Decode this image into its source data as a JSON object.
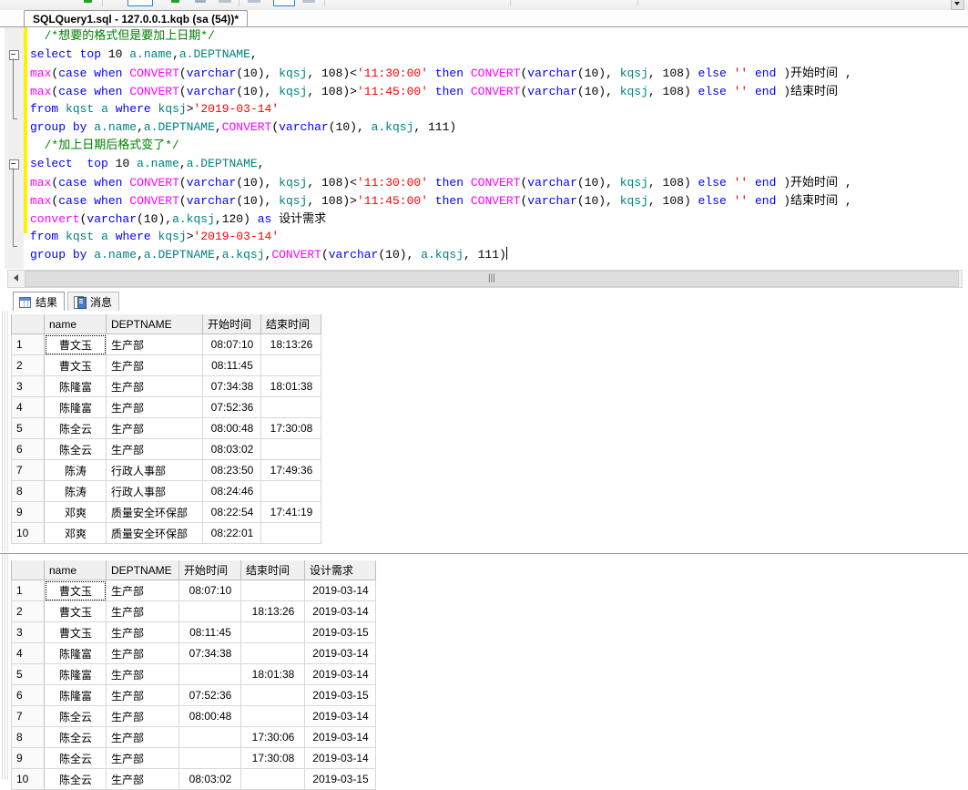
{
  "window": {
    "tab_title": "SQLQuery1.sql - 127.0.0.1.kqb (sa (54))*"
  },
  "editor": {
    "lines": [
      [
        {
          "t": "  /*想要的格式但是要加上日期*/",
          "c": "cmt"
        }
      ],
      [
        {
          "t": "select",
          "c": "kw"
        },
        {
          "t": " ",
          "c": "pl"
        },
        {
          "t": "top",
          "c": "kw"
        },
        {
          "t": " ",
          "c": "pl"
        },
        {
          "t": "10",
          "c": "num"
        },
        {
          "t": " ",
          "c": "pl"
        },
        {
          "t": "a.name",
          "c": "id"
        },
        {
          "t": ",",
          "c": "pl"
        },
        {
          "t": "a.DEPTNAME",
          "c": "id"
        },
        {
          "t": ",",
          "c": "pl"
        }
      ],
      [
        {
          "t": "max",
          "c": "fn"
        },
        {
          "t": "(",
          "c": "pl"
        },
        {
          "t": "case",
          "c": "kw"
        },
        {
          "t": " ",
          "c": "pl"
        },
        {
          "t": "when",
          "c": "kw"
        },
        {
          "t": " ",
          "c": "pl"
        },
        {
          "t": "CONVERT",
          "c": "fn"
        },
        {
          "t": "(",
          "c": "pl"
        },
        {
          "t": "varchar",
          "c": "kw"
        },
        {
          "t": "(",
          "c": "pl"
        },
        {
          "t": "10",
          "c": "num"
        },
        {
          "t": "), ",
          "c": "pl"
        },
        {
          "t": "kqsj",
          "c": "id"
        },
        {
          "t": ", ",
          "c": "pl"
        },
        {
          "t": "108",
          "c": "num"
        },
        {
          "t": ")<",
          "c": "pl"
        },
        {
          "t": "'11:30:00'",
          "c": "str"
        },
        {
          "t": " ",
          "c": "pl"
        },
        {
          "t": "then",
          "c": "kw"
        },
        {
          "t": " ",
          "c": "pl"
        },
        {
          "t": "CONVERT",
          "c": "fn"
        },
        {
          "t": "(",
          "c": "pl"
        },
        {
          "t": "varchar",
          "c": "kw"
        },
        {
          "t": "(",
          "c": "pl"
        },
        {
          "t": "10",
          "c": "num"
        },
        {
          "t": "), ",
          "c": "pl"
        },
        {
          "t": "kqsj",
          "c": "id"
        },
        {
          "t": ", ",
          "c": "pl"
        },
        {
          "t": "108",
          "c": "num"
        },
        {
          "t": ") ",
          "c": "pl"
        },
        {
          "t": "else",
          "c": "kw"
        },
        {
          "t": " ",
          "c": "pl"
        },
        {
          "t": "''",
          "c": "str"
        },
        {
          "t": " ",
          "c": "pl"
        },
        {
          "t": "end",
          "c": "kw"
        },
        {
          "t": " )",
          "c": "pl"
        },
        {
          "t": "开始时间",
          "c": "cn"
        },
        {
          "t": " ,",
          "c": "pl"
        }
      ],
      [
        {
          "t": "max",
          "c": "fn"
        },
        {
          "t": "(",
          "c": "pl"
        },
        {
          "t": "case",
          "c": "kw"
        },
        {
          "t": " ",
          "c": "pl"
        },
        {
          "t": "when",
          "c": "kw"
        },
        {
          "t": " ",
          "c": "pl"
        },
        {
          "t": "CONVERT",
          "c": "fn"
        },
        {
          "t": "(",
          "c": "pl"
        },
        {
          "t": "varchar",
          "c": "kw"
        },
        {
          "t": "(",
          "c": "pl"
        },
        {
          "t": "10",
          "c": "num"
        },
        {
          "t": "), ",
          "c": "pl"
        },
        {
          "t": "kqsj",
          "c": "id"
        },
        {
          "t": ", ",
          "c": "pl"
        },
        {
          "t": "108",
          "c": "num"
        },
        {
          "t": ")>",
          "c": "pl"
        },
        {
          "t": "'11:45:00'",
          "c": "str"
        },
        {
          "t": " ",
          "c": "pl"
        },
        {
          "t": "then",
          "c": "kw"
        },
        {
          "t": " ",
          "c": "pl"
        },
        {
          "t": "CONVERT",
          "c": "fn"
        },
        {
          "t": "(",
          "c": "pl"
        },
        {
          "t": "varchar",
          "c": "kw"
        },
        {
          "t": "(",
          "c": "pl"
        },
        {
          "t": "10",
          "c": "num"
        },
        {
          "t": "), ",
          "c": "pl"
        },
        {
          "t": "kqsj",
          "c": "id"
        },
        {
          "t": ", ",
          "c": "pl"
        },
        {
          "t": "108",
          "c": "num"
        },
        {
          "t": ") ",
          "c": "pl"
        },
        {
          "t": "else",
          "c": "kw"
        },
        {
          "t": " ",
          "c": "pl"
        },
        {
          "t": "''",
          "c": "str"
        },
        {
          "t": " ",
          "c": "pl"
        },
        {
          "t": "end",
          "c": "kw"
        },
        {
          "t": " )",
          "c": "pl"
        },
        {
          "t": "结束时间",
          "c": "cn"
        }
      ],
      [
        {
          "t": "from",
          "c": "kw"
        },
        {
          "t": " ",
          "c": "pl"
        },
        {
          "t": "kqst",
          "c": "id"
        },
        {
          "t": " ",
          "c": "pl"
        },
        {
          "t": "a",
          "c": "id"
        },
        {
          "t": " ",
          "c": "pl"
        },
        {
          "t": "where",
          "c": "kw"
        },
        {
          "t": " ",
          "c": "pl"
        },
        {
          "t": "kqsj",
          "c": "id"
        },
        {
          "t": ">",
          "c": "pl"
        },
        {
          "t": "'2019-03-14'",
          "c": "str"
        }
      ],
      [
        {
          "t": "group",
          "c": "kw"
        },
        {
          "t": " ",
          "c": "pl"
        },
        {
          "t": "by",
          "c": "kw"
        },
        {
          "t": " ",
          "c": "pl"
        },
        {
          "t": "a.name",
          "c": "id"
        },
        {
          "t": ",",
          "c": "pl"
        },
        {
          "t": "a.DEPTNAME",
          "c": "id"
        },
        {
          "t": ",",
          "c": "pl"
        },
        {
          "t": "CONVERT",
          "c": "fn"
        },
        {
          "t": "(",
          "c": "pl"
        },
        {
          "t": "varchar",
          "c": "kw"
        },
        {
          "t": "(",
          "c": "pl"
        },
        {
          "t": "10",
          "c": "num"
        },
        {
          "t": "), ",
          "c": "pl"
        },
        {
          "t": "a.kqsj",
          "c": "id"
        },
        {
          "t": ", ",
          "c": "pl"
        },
        {
          "t": "111",
          "c": "num"
        },
        {
          "t": ")",
          "c": "pl"
        }
      ],
      [
        {
          "t": "  /*加上日期后格式变了*/",
          "c": "cmt"
        }
      ],
      [
        {
          "t": "select",
          "c": "kw"
        },
        {
          "t": "  ",
          "c": "pl"
        },
        {
          "t": "top",
          "c": "kw"
        },
        {
          "t": " ",
          "c": "pl"
        },
        {
          "t": "10",
          "c": "num"
        },
        {
          "t": " ",
          "c": "pl"
        },
        {
          "t": "a.name",
          "c": "id"
        },
        {
          "t": ",",
          "c": "pl"
        },
        {
          "t": "a.DEPTNAME",
          "c": "id"
        },
        {
          "t": ",",
          "c": "pl"
        }
      ],
      [
        {
          "t": "max",
          "c": "fn"
        },
        {
          "t": "(",
          "c": "pl"
        },
        {
          "t": "case",
          "c": "kw"
        },
        {
          "t": " ",
          "c": "pl"
        },
        {
          "t": "when",
          "c": "kw"
        },
        {
          "t": " ",
          "c": "pl"
        },
        {
          "t": "CONVERT",
          "c": "fn"
        },
        {
          "t": "(",
          "c": "pl"
        },
        {
          "t": "varchar",
          "c": "kw"
        },
        {
          "t": "(",
          "c": "pl"
        },
        {
          "t": "10",
          "c": "num"
        },
        {
          "t": "), ",
          "c": "pl"
        },
        {
          "t": "kqsj",
          "c": "id"
        },
        {
          "t": ", ",
          "c": "pl"
        },
        {
          "t": "108",
          "c": "num"
        },
        {
          "t": ")<",
          "c": "pl"
        },
        {
          "t": "'11:30:00'",
          "c": "str"
        },
        {
          "t": " ",
          "c": "pl"
        },
        {
          "t": "then",
          "c": "kw"
        },
        {
          "t": " ",
          "c": "pl"
        },
        {
          "t": "CONVERT",
          "c": "fn"
        },
        {
          "t": "(",
          "c": "pl"
        },
        {
          "t": "varchar",
          "c": "kw"
        },
        {
          "t": "(",
          "c": "pl"
        },
        {
          "t": "10",
          "c": "num"
        },
        {
          "t": "), ",
          "c": "pl"
        },
        {
          "t": "kqsj",
          "c": "id"
        },
        {
          "t": ", ",
          "c": "pl"
        },
        {
          "t": "108",
          "c": "num"
        },
        {
          "t": ") ",
          "c": "pl"
        },
        {
          "t": "else",
          "c": "kw"
        },
        {
          "t": " ",
          "c": "pl"
        },
        {
          "t": "''",
          "c": "str"
        },
        {
          "t": " ",
          "c": "pl"
        },
        {
          "t": "end",
          "c": "kw"
        },
        {
          "t": " )",
          "c": "pl"
        },
        {
          "t": "开始时间",
          "c": "cn"
        },
        {
          "t": " ,",
          "c": "pl"
        }
      ],
      [
        {
          "t": "max",
          "c": "fn"
        },
        {
          "t": "(",
          "c": "pl"
        },
        {
          "t": "case",
          "c": "kw"
        },
        {
          "t": " ",
          "c": "pl"
        },
        {
          "t": "when",
          "c": "kw"
        },
        {
          "t": " ",
          "c": "pl"
        },
        {
          "t": "CONVERT",
          "c": "fn"
        },
        {
          "t": "(",
          "c": "pl"
        },
        {
          "t": "varchar",
          "c": "kw"
        },
        {
          "t": "(",
          "c": "pl"
        },
        {
          "t": "10",
          "c": "num"
        },
        {
          "t": "), ",
          "c": "pl"
        },
        {
          "t": "kqsj",
          "c": "id"
        },
        {
          "t": ", ",
          "c": "pl"
        },
        {
          "t": "108",
          "c": "num"
        },
        {
          "t": ")>",
          "c": "pl"
        },
        {
          "t": "'11:45:00'",
          "c": "str"
        },
        {
          "t": " ",
          "c": "pl"
        },
        {
          "t": "then",
          "c": "kw"
        },
        {
          "t": " ",
          "c": "pl"
        },
        {
          "t": "CONVERT",
          "c": "fn"
        },
        {
          "t": "(",
          "c": "pl"
        },
        {
          "t": "varchar",
          "c": "kw"
        },
        {
          "t": "(",
          "c": "pl"
        },
        {
          "t": "10",
          "c": "num"
        },
        {
          "t": "), ",
          "c": "pl"
        },
        {
          "t": "kqsj",
          "c": "id"
        },
        {
          "t": ", ",
          "c": "pl"
        },
        {
          "t": "108",
          "c": "num"
        },
        {
          "t": ") ",
          "c": "pl"
        },
        {
          "t": "else",
          "c": "kw"
        },
        {
          "t": " ",
          "c": "pl"
        },
        {
          "t": "''",
          "c": "str"
        },
        {
          "t": " ",
          "c": "pl"
        },
        {
          "t": "end",
          "c": "kw"
        },
        {
          "t": " )",
          "c": "pl"
        },
        {
          "t": "结束时间",
          "c": "cn"
        },
        {
          "t": " ,",
          "c": "pl"
        }
      ],
      [
        {
          "t": "convert",
          "c": "fn"
        },
        {
          "t": "(",
          "c": "pl"
        },
        {
          "t": "varchar",
          "c": "kw"
        },
        {
          "t": "(",
          "c": "pl"
        },
        {
          "t": "10",
          "c": "num"
        },
        {
          "t": "),",
          "c": "pl"
        },
        {
          "t": "a.kqsj",
          "c": "id"
        },
        {
          "t": ",",
          "c": "pl"
        },
        {
          "t": "120",
          "c": "num"
        },
        {
          "t": ") ",
          "c": "pl"
        },
        {
          "t": "as",
          "c": "kw"
        },
        {
          "t": " ",
          "c": "pl"
        },
        {
          "t": "设计需求",
          "c": "cn"
        }
      ],
      [
        {
          "t": "from",
          "c": "kw"
        },
        {
          "t": " ",
          "c": "pl"
        },
        {
          "t": "kqst",
          "c": "id"
        },
        {
          "t": " ",
          "c": "pl"
        },
        {
          "t": "a",
          "c": "id"
        },
        {
          "t": " ",
          "c": "pl"
        },
        {
          "t": "where",
          "c": "kw"
        },
        {
          "t": " ",
          "c": "pl"
        },
        {
          "t": "kqsj",
          "c": "id"
        },
        {
          "t": ">",
          "c": "pl"
        },
        {
          "t": "'2019-03-14'",
          "c": "str"
        }
      ],
      [
        {
          "t": "group",
          "c": "kw"
        },
        {
          "t": " ",
          "c": "pl"
        },
        {
          "t": "by",
          "c": "kw"
        },
        {
          "t": " ",
          "c": "pl"
        },
        {
          "t": "a.name",
          "c": "id"
        },
        {
          "t": ",",
          "c": "pl"
        },
        {
          "t": "a.DEPTNAME",
          "c": "id"
        },
        {
          "t": ",",
          "c": "pl"
        },
        {
          "t": "a.kqsj",
          "c": "id"
        },
        {
          "t": ",",
          "c": "pl"
        },
        {
          "t": "CONVERT",
          "c": "fn"
        },
        {
          "t": "(",
          "c": "pl"
        },
        {
          "t": "varchar",
          "c": "kw"
        },
        {
          "t": "(",
          "c": "pl"
        },
        {
          "t": "10",
          "c": "num"
        },
        {
          "t": "), ",
          "c": "pl"
        },
        {
          "t": "a.kqsj",
          "c": "id"
        },
        {
          "t": ", ",
          "c": "pl"
        },
        {
          "t": "111",
          "c": "num"
        },
        {
          "t": ")",
          "c": "pl"
        }
      ]
    ]
  },
  "hscroll": {
    "grip": "|||"
  },
  "result_tabs": [
    {
      "label": "结果",
      "icon": "grid-icon",
      "active": true
    },
    {
      "label": "消息",
      "icon": "message-icon",
      "active": false
    }
  ],
  "grid1": {
    "columns": [
      "",
      "name",
      "DEPTNAME",
      "开始时间",
      "结束时间"
    ],
    "rows": [
      [
        "1",
        "曹文玉",
        "生产部",
        "08:07:10",
        "18:13:26"
      ],
      [
        "2",
        "曹文玉",
        "生产部",
        "08:11:45",
        ""
      ],
      [
        "3",
        "陈隆富",
        "生产部",
        "07:34:38",
        "18:01:38"
      ],
      [
        "4",
        "陈隆富",
        "生产部",
        "07:52:36",
        ""
      ],
      [
        "5",
        "陈全云",
        "生产部",
        "08:00:48",
        "17:30:08"
      ],
      [
        "6",
        "陈全云",
        "生产部",
        "08:03:02",
        ""
      ],
      [
        "7",
        "陈涛",
        "行政人事部",
        "08:23:50",
        "17:49:36"
      ],
      [
        "8",
        "陈涛",
        "行政人事部",
        "08:24:46",
        ""
      ],
      [
        "9",
        "邓爽",
        "质量安全环保部",
        "08:22:54",
        "17:41:19"
      ],
      [
        "10",
        "邓爽",
        "质量安全环保部",
        "08:22:01",
        ""
      ]
    ]
  },
  "grid2": {
    "columns": [
      "",
      "name",
      "DEPTNAME",
      "开始时间",
      "结束时间",
      "设计需求"
    ],
    "rows": [
      [
        "1",
        "曹文玉",
        "生产部",
        "08:07:10",
        "",
        "2019-03-14"
      ],
      [
        "2",
        "曹文玉",
        "生产部",
        "",
        "18:13:26",
        "2019-03-14"
      ],
      [
        "3",
        "曹文玉",
        "生产部",
        "08:11:45",
        "",
        "2019-03-15"
      ],
      [
        "4",
        "陈隆富",
        "生产部",
        "07:34:38",
        "",
        "2019-03-14"
      ],
      [
        "5",
        "陈隆富",
        "生产部",
        "",
        "18:01:38",
        "2019-03-14"
      ],
      [
        "6",
        "陈隆富",
        "生产部",
        "07:52:36",
        "",
        "2019-03-15"
      ],
      [
        "7",
        "陈全云",
        "生产部",
        "08:00:48",
        "",
        "2019-03-14"
      ],
      [
        "8",
        "陈全云",
        "生产部",
        "",
        "17:30:06",
        "2019-03-14"
      ],
      [
        "9",
        "陈全云",
        "生产部",
        "",
        "17:30:08",
        "2019-03-14"
      ],
      [
        "10",
        "陈全云",
        "生产部",
        "08:03:02",
        "",
        "2019-03-15"
      ]
    ]
  }
}
